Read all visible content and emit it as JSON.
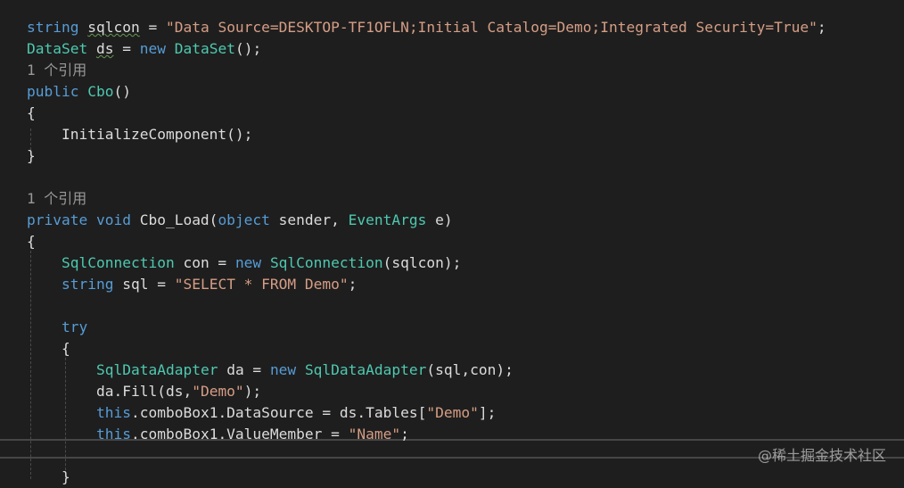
{
  "theme": {
    "background": "#1e1e1e",
    "keyword": "#569cd6",
    "type": "#4ec9b0",
    "string": "#d69d85",
    "plain": "#dcdcdc",
    "codelens": "#999999"
  },
  "code_lines": [
    {
      "id": "line-sqlcon",
      "type": "code",
      "indent": 0,
      "tokens": [
        {
          "t": "string",
          "c": "kw"
        },
        {
          "t": " ",
          "c": "plain"
        },
        {
          "t": "sqlcon",
          "c": "plain",
          "squiggle": true
        },
        {
          "t": " = ",
          "c": "plain"
        },
        {
          "t": "\"Data Source=DESKTOP-TF1OFLN;Initial Catalog=Demo;Integrated Security=True\"",
          "c": "str"
        },
        {
          "t": ";",
          "c": "plain"
        }
      ]
    },
    {
      "id": "line-dataset",
      "type": "code",
      "indent": 0,
      "tokens": [
        {
          "t": "DataSet",
          "c": "type"
        },
        {
          "t": " ",
          "c": "plain"
        },
        {
          "t": "ds",
          "c": "plain",
          "squiggle": true
        },
        {
          "t": " = ",
          "c": "plain"
        },
        {
          "t": "new",
          "c": "kw"
        },
        {
          "t": " ",
          "c": "plain"
        },
        {
          "t": "DataSet",
          "c": "type"
        },
        {
          "t": "();",
          "c": "plain"
        }
      ]
    },
    {
      "id": "lens-1",
      "type": "lens",
      "indent": 0,
      "tokens": [
        {
          "t": "1 个引用",
          "c": "lens"
        }
      ]
    },
    {
      "id": "line-ctor",
      "type": "code",
      "indent": 0,
      "tokens": [
        {
          "t": "public",
          "c": "kw"
        },
        {
          "t": " ",
          "c": "plain"
        },
        {
          "t": "Cbo",
          "c": "type"
        },
        {
          "t": "()",
          "c": "plain"
        }
      ]
    },
    {
      "id": "line-brace-open-1",
      "type": "code",
      "indent": 0,
      "tokens": [
        {
          "t": "{",
          "c": "plain"
        }
      ]
    },
    {
      "id": "line-init",
      "type": "code",
      "indent": 1,
      "tokens": [
        {
          "t": "InitializeComponent();",
          "c": "plain"
        }
      ]
    },
    {
      "id": "line-brace-close-1",
      "type": "code",
      "indent": 0,
      "tokens": [
        {
          "t": "}",
          "c": "plain"
        }
      ]
    },
    {
      "id": "line-blank-1",
      "type": "blank",
      "indent": 0,
      "tokens": []
    },
    {
      "id": "lens-2",
      "type": "lens",
      "indent": 0,
      "tokens": [
        {
          "t": "1 个引用",
          "c": "lens"
        }
      ]
    },
    {
      "id": "line-load",
      "type": "code",
      "indent": 0,
      "tokens": [
        {
          "t": "private",
          "c": "kw"
        },
        {
          "t": " ",
          "c": "plain"
        },
        {
          "t": "void",
          "c": "kw"
        },
        {
          "t": " Cbo_Load(",
          "c": "plain"
        },
        {
          "t": "object",
          "c": "kw"
        },
        {
          "t": " sender, ",
          "c": "plain"
        },
        {
          "t": "EventArgs",
          "c": "type"
        },
        {
          "t": " e)",
          "c": "plain"
        }
      ]
    },
    {
      "id": "line-brace-open-2",
      "type": "code",
      "indent": 0,
      "tokens": [
        {
          "t": "{",
          "c": "plain"
        }
      ]
    },
    {
      "id": "line-con",
      "type": "code",
      "indent": 1,
      "tokens": [
        {
          "t": "SqlConnection",
          "c": "type"
        },
        {
          "t": " con = ",
          "c": "plain"
        },
        {
          "t": "new",
          "c": "kw"
        },
        {
          "t": " ",
          "c": "plain"
        },
        {
          "t": "SqlConnection",
          "c": "type"
        },
        {
          "t": "(sqlcon);",
          "c": "plain"
        }
      ]
    },
    {
      "id": "line-sql",
      "type": "code",
      "indent": 1,
      "tokens": [
        {
          "t": "string",
          "c": "kw"
        },
        {
          "t": " sql = ",
          "c": "plain"
        },
        {
          "t": "\"SELECT * FROM Demo\"",
          "c": "str"
        },
        {
          "t": ";",
          "c": "plain"
        }
      ]
    },
    {
      "id": "line-blank-2",
      "type": "blank",
      "indent": 1,
      "tokens": []
    },
    {
      "id": "line-try",
      "type": "code",
      "indent": 1,
      "tokens": [
        {
          "t": "try",
          "c": "kw"
        }
      ]
    },
    {
      "id": "line-brace-open-3",
      "type": "code",
      "indent": 1,
      "tokens": [
        {
          "t": "{",
          "c": "plain"
        }
      ]
    },
    {
      "id": "line-adapter",
      "type": "code",
      "indent": 2,
      "tokens": [
        {
          "t": "SqlDataAdapter",
          "c": "type"
        },
        {
          "t": " da = ",
          "c": "plain"
        },
        {
          "t": "new",
          "c": "kw"
        },
        {
          "t": " ",
          "c": "plain"
        },
        {
          "t": "SqlDataAdapter",
          "c": "type"
        },
        {
          "t": "(sql,con);",
          "c": "plain"
        }
      ]
    },
    {
      "id": "line-fill",
      "type": "code",
      "indent": 2,
      "tokens": [
        {
          "t": "da.Fill(ds,",
          "c": "plain"
        },
        {
          "t": "\"Demo\"",
          "c": "str"
        },
        {
          "t": ");",
          "c": "plain"
        }
      ]
    },
    {
      "id": "line-datasource",
      "type": "code",
      "indent": 2,
      "tokens": [
        {
          "t": "this",
          "c": "kw"
        },
        {
          "t": ".comboBox1.DataSource = ds.Tables[",
          "c": "plain"
        },
        {
          "t": "\"Demo\"",
          "c": "str"
        },
        {
          "t": "];",
          "c": "plain"
        }
      ]
    },
    {
      "id": "line-valuemember",
      "type": "code",
      "indent": 2,
      "tokens": [
        {
          "t": "this",
          "c": "kw"
        },
        {
          "t": ".comboBox1.ValueMember = ",
          "c": "plain"
        },
        {
          "t": "\"Name\"",
          "c": "str"
        },
        {
          "t": ";",
          "c": "plain"
        }
      ]
    },
    {
      "id": "line-blank-3",
      "type": "blank",
      "indent": 2,
      "tokens": []
    },
    {
      "id": "line-brace-close-3",
      "type": "code",
      "indent": 1,
      "tokens": [
        {
          "t": "}",
          "c": "plain"
        }
      ]
    }
  ],
  "watermark": "@稀土掘金技术社区"
}
